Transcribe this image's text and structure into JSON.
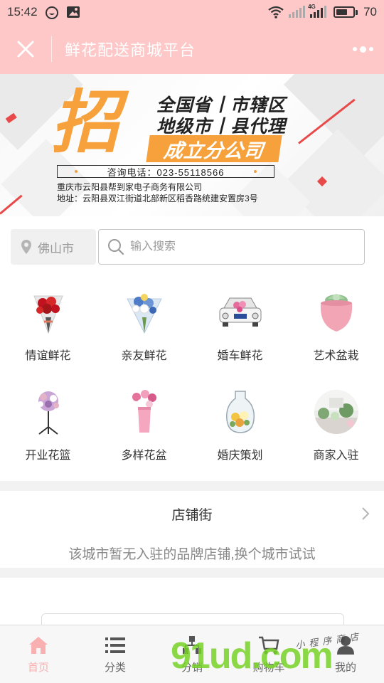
{
  "status_bar": {
    "time": "15:42",
    "battery": "70",
    "battery_level": 0.7,
    "network_label": "4G"
  },
  "title_bar": {
    "title": "鲜花配送商城平台"
  },
  "banner": {
    "big_char": "招",
    "line1": "全国省丨市辖区",
    "line2": "地级市丨县代理",
    "highlight": "成立分公司",
    "phone": "咨询电话：023-55118566",
    "company": "重庆市云阳县帮到家电子商务有限公司",
    "address": "地址：云阳县双江街道北部新区稻香路统建安置房3号"
  },
  "location": {
    "city": "佛山市"
  },
  "search": {
    "placeholder": "输入搜索"
  },
  "categories": [
    {
      "label": "情谊鲜花",
      "icon": "red-rose-bouquet"
    },
    {
      "label": "亲友鲜花",
      "icon": "blue-white-bouquet"
    },
    {
      "label": "婚车鲜花",
      "icon": "wedding-car"
    },
    {
      "label": "艺术盆栽",
      "icon": "pink-pot-succulent"
    },
    {
      "label": "开业花篮",
      "icon": "flower-stand"
    },
    {
      "label": "多样花盆",
      "icon": "pink-vase-flowers"
    },
    {
      "label": "婚庆策划",
      "icon": "glass-vase-roses"
    },
    {
      "label": "商家入驻",
      "icon": "shop-photo"
    }
  ],
  "shop_street": {
    "title": "店铺街",
    "empty_text": "该城市暂无入驻的品牌店铺,换个城市试试"
  },
  "tabs": [
    {
      "label": "首页",
      "icon": "home-icon",
      "active": true
    },
    {
      "label": "分类",
      "icon": "list-icon",
      "active": false
    },
    {
      "label": "分销",
      "icon": "share-icon",
      "active": false
    },
    {
      "label": "购物车",
      "icon": "cart-icon",
      "active": false
    },
    {
      "label": "我的",
      "icon": "user-icon",
      "active": false
    }
  ],
  "watermark": {
    "brand": "91ud.com",
    "sub": "小程序商店"
  },
  "colors": {
    "header_pink": "#ffc8c8",
    "banner_orange": "#f6a13c",
    "active_tab": "#f9b0b0"
  }
}
